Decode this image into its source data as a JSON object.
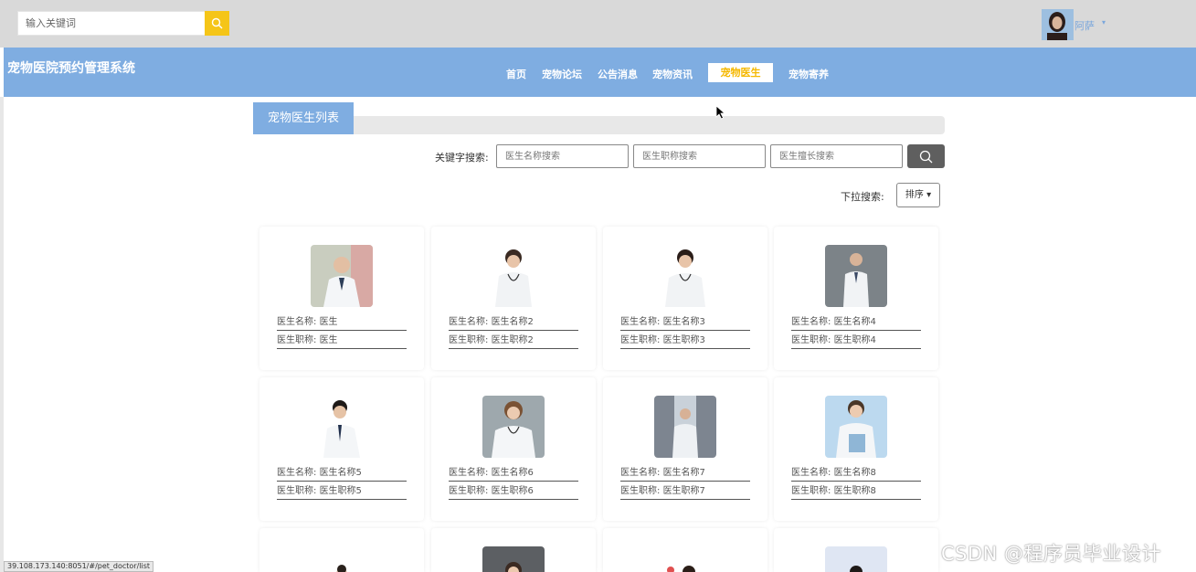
{
  "topbar": {
    "search_placeholder": "输入关键词",
    "user_name": "阿萨",
    "caret": "▾"
  },
  "nav": {
    "site_title": "宠物医院预约管理系统",
    "items": [
      {
        "label": "首页"
      },
      {
        "label": "宠物论坛"
      },
      {
        "label": "公告消息"
      },
      {
        "label": "宠物资讯"
      },
      {
        "label": "宠物医生",
        "active": true
      },
      {
        "label": "宠物寄养"
      }
    ]
  },
  "panel": {
    "title": "宠物医生列表",
    "keyword_label": "关键字搜索:",
    "name_placeholder": "医生名称搜索",
    "title_placeholder": "医生职称搜索",
    "skill_placeholder": "医生擅长搜索",
    "dropdown_label": "下拉搜索:",
    "sort_label": "排序 ▾"
  },
  "doctors": [
    {
      "name_label": "医生名称:",
      "name": "医生",
      "title_label": "医生职称:",
      "title": "医生"
    },
    {
      "name_label": "医生名称:",
      "name": "医生名称2",
      "title_label": "医生职称:",
      "title": "医生职称2"
    },
    {
      "name_label": "医生名称:",
      "name": "医生名称3",
      "title_label": "医生职称:",
      "title": "医生职称3"
    },
    {
      "name_label": "医生名称:",
      "name": "医生名称4",
      "title_label": "医生职称:",
      "title": "医生职称4"
    },
    {
      "name_label": "医生名称:",
      "name": "医生名称5",
      "title_label": "医生职称:",
      "title": "医生职称5"
    },
    {
      "name_label": "医生名称:",
      "name": "医生名称6",
      "title_label": "医生职称:",
      "title": "医生职称6"
    },
    {
      "name_label": "医生名称:",
      "name": "医生名称7",
      "title_label": "医生职称:",
      "title": "医生职称7"
    },
    {
      "name_label": "医生名称:",
      "name": "医生名称8",
      "title_label": "医生职称:",
      "title": "医生职称8"
    }
  ],
  "status_url": "39.108.173.140:8051/#/pet_doctor/list",
  "watermark": "CSDN @程序员毕业设计",
  "colors": {
    "nav_blue": "#7fade1",
    "accent_yellow": "#f5c518",
    "active_text": "#f5b800",
    "search_btn_dark": "#5f5f5f"
  }
}
